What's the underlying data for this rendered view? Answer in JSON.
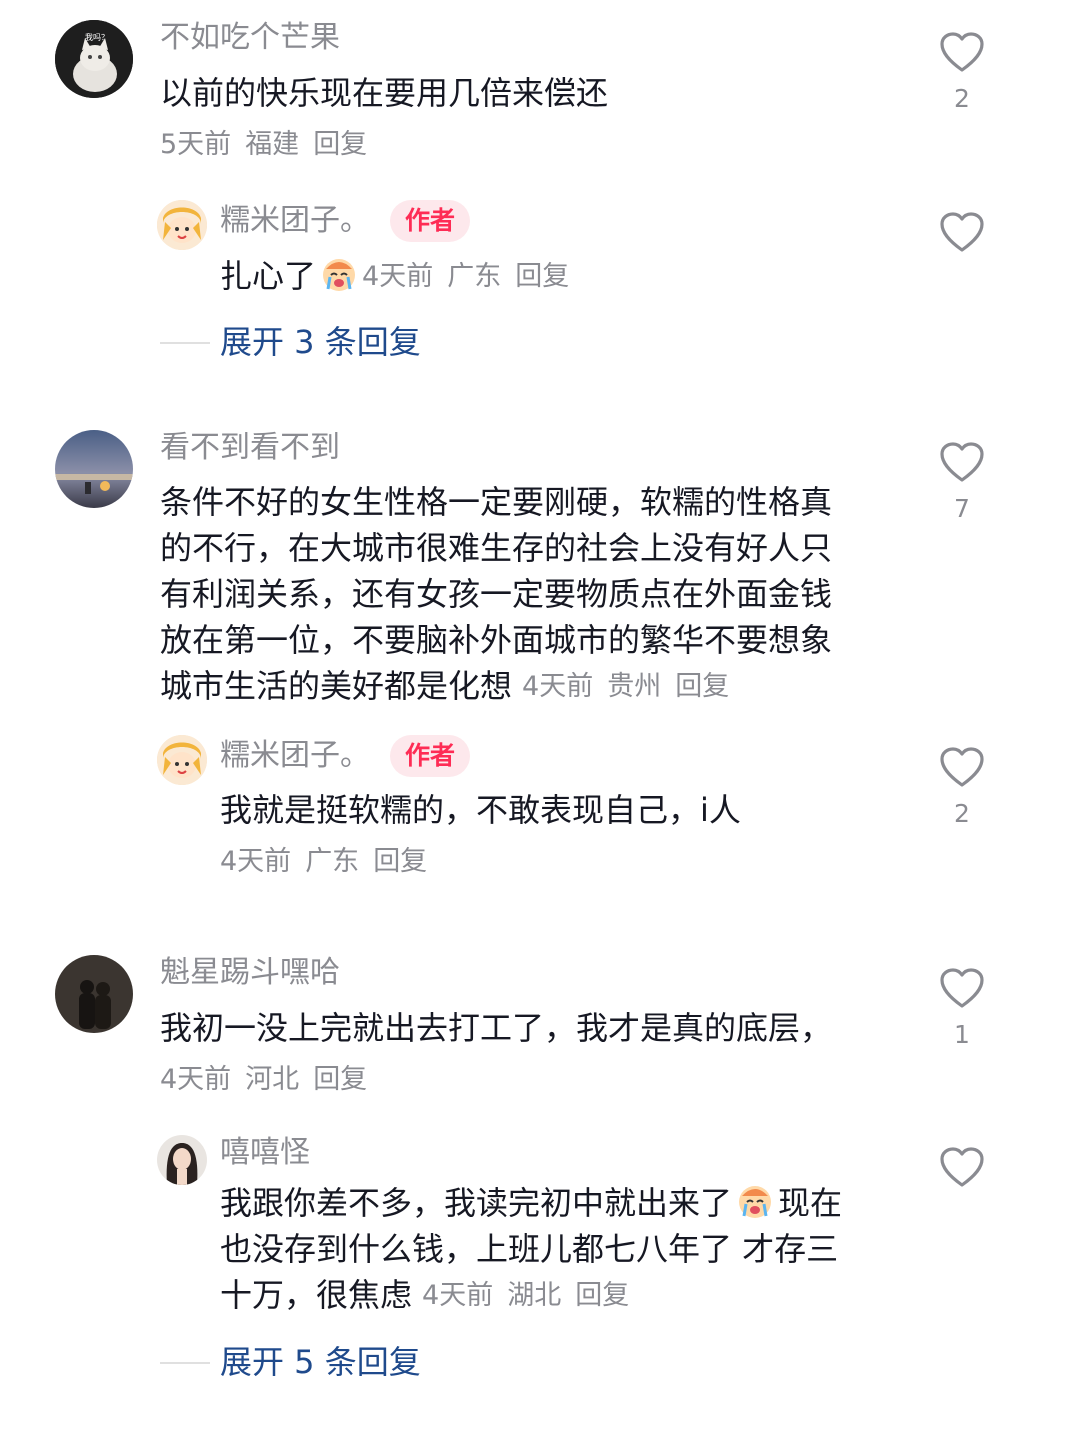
{
  "comments": [
    {
      "username": "不如吃个芒果",
      "avatar_text": "我吗？",
      "text": "以前的快乐现在要用几倍来偿还",
      "time": "5天前",
      "location": "福建",
      "reply": "回复",
      "likes": "2",
      "replies": [
        {
          "username": "糯米团子。",
          "tag": "作者",
          "text": "扎心了",
          "emoji": "crying-face-emoji",
          "time": "4天前",
          "location": "广东",
          "reply": "回复",
          "likes": ""
        }
      ],
      "expand": "展开 3 条回复"
    },
    {
      "username": "看不到看不到",
      "text": "条件不好的女生性格一定要刚硬，软糯的性格真的不行，在大城市很难生存的社会上没有好人只有利润关系，还有女孩一定要物质点在外面金钱放在第一位，不要脑补外面城市的繁华不要想象城市生活的美好都是化想",
      "text_lines": [
        "条件不好的女生性格一定要刚硬，软糯的性格真",
        "的不行，在大城市很难生存的社会上没有好人只",
        "有利润关系，还有女孩一定要物质点在外面金钱",
        "放在第一位，不要脑补外面城市的繁华不要想象",
        "城市生活的美好都是化想"
      ],
      "time": "4天前",
      "location": "贵州",
      "reply": "回复",
      "likes": "7",
      "replies": [
        {
          "username": "糯米团子。",
          "tag": "作者",
          "text": "我就是挺软糯的，不敢表现自己，i人",
          "time": "4天前",
          "location": "广东",
          "reply": "回复",
          "likes": "2"
        }
      ]
    },
    {
      "username": "魁星踢斗嘿哈",
      "text": "我初一没上完就出去打工了，我才是真的底层，",
      "time": "4天前",
      "location": "河北",
      "reply": "回复",
      "likes": "1",
      "replies": [
        {
          "username": "嘻嘻怪",
          "text_lines": [
            "我跟你差不多，我读完初中就出来了",
            "现在",
            "也没存到什么钱，上班儿都七八年了 才存三",
            "十万，很焦虑"
          ],
          "emoji": "crying-face-emoji",
          "time": "4天前",
          "location": "湖北",
          "reply": "回复",
          "likes": ""
        }
      ],
      "expand": "展开 5 条回复"
    }
  ],
  "icons": {
    "like": "heart-outline-icon"
  },
  "colors": {
    "author_tag_bg": "#fde8ec",
    "author_tag_text": "#fe2c55",
    "expand_link": "#1f4a8c",
    "meta_gray": "#8a8b91"
  }
}
